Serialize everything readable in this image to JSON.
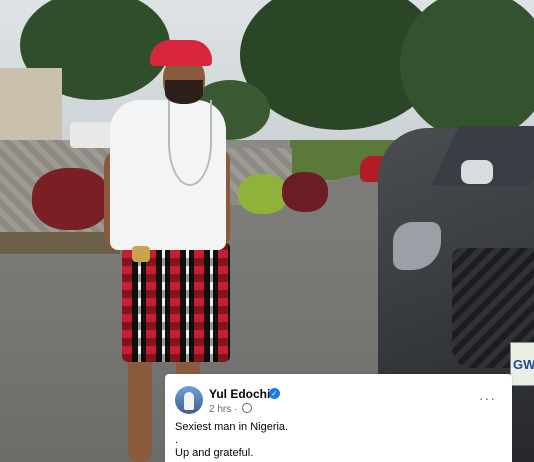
{
  "post": {
    "author": "Yul Edochie",
    "verified_icon": "check",
    "time": "2 hrs",
    "separator": "·",
    "audience_icon": "globe-icon",
    "more_icon": "···",
    "lines": [
      "Sexiest man in Nigeria.",
      ".",
      "Up and grateful."
    ]
  },
  "plate": {
    "text": "GW"
  },
  "colors": {
    "verified": "#1877f2",
    "cap": "#d7263d",
    "red_car": "#b21d25"
  }
}
